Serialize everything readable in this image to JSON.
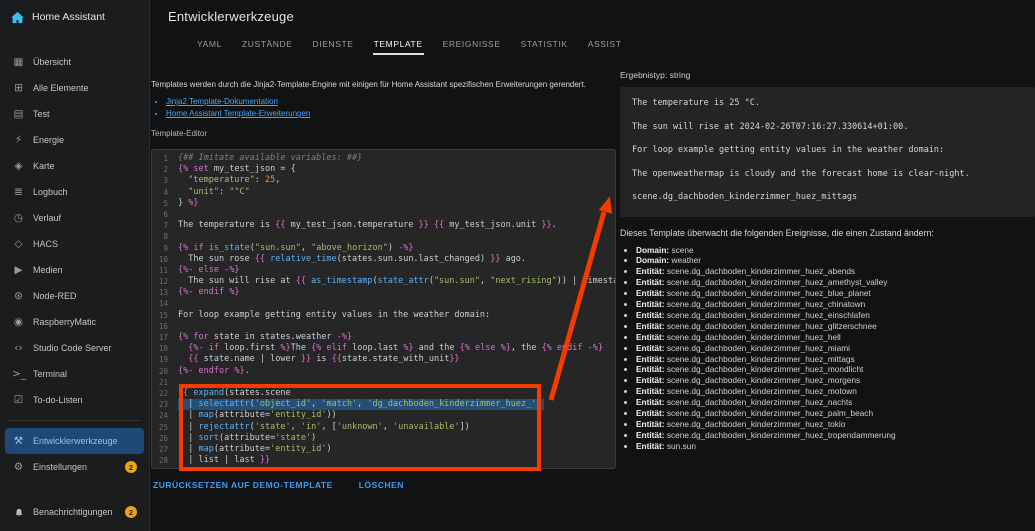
{
  "colors": {
    "accent": "#3d9df6",
    "active_item_bg": "#1e4976",
    "badge": "#eea410",
    "annotation": "#f53b00"
  },
  "sidebar": {
    "title": "Home Assistant",
    "items": [
      {
        "label": "Übersicht",
        "icon": "view-dashboard-icon",
        "glyph": "▦"
      },
      {
        "label": "Alle Elemente",
        "icon": "shapes-icon",
        "glyph": "⊞"
      },
      {
        "label": "Test",
        "icon": "grid-icon",
        "glyph": "▤"
      },
      {
        "label": "Energie",
        "icon": "lightning-icon",
        "glyph": "⚡"
      },
      {
        "label": "Karte",
        "icon": "map-icon",
        "glyph": "◈"
      },
      {
        "label": "Logbuch",
        "icon": "logbook-icon",
        "glyph": "≣"
      },
      {
        "label": "Verlauf",
        "icon": "history-clock-icon",
        "glyph": "◷"
      },
      {
        "label": "HACS",
        "icon": "hacs-icon",
        "glyph": "◇"
      },
      {
        "label": "Medien",
        "icon": "media-play-icon",
        "glyph": "▶"
      },
      {
        "label": "Node-RED",
        "icon": "node-red-icon",
        "glyph": "⊛"
      },
      {
        "label": "RaspberryMatic",
        "icon": "raspberrymatic-icon",
        "glyph": "◉"
      },
      {
        "label": "Studio Code Server",
        "icon": "code-brackets-icon",
        "glyph": "‹›"
      },
      {
        "label": "Terminal",
        "icon": "terminal-icon",
        "glyph": ">_"
      },
      {
        "label": "To-do-Listen",
        "icon": "todo-check-icon",
        "glyph": "☑"
      },
      {
        "label": "Entwicklerwerkzeuge",
        "icon": "hammer-icon",
        "glyph": "⚒",
        "active": true,
        "divider_before": true
      },
      {
        "label": "Einstellungen",
        "icon": "gear-icon",
        "glyph": "⚙",
        "badge": "2"
      }
    ],
    "bottom_item": {
      "label": "Benachrichtigungen",
      "icon": "bell-icon",
      "badge": "2"
    }
  },
  "header": {
    "title": "Entwicklerwerkzeuge"
  },
  "tabs": {
    "items": [
      "YAML",
      "ZUSTÄNDE",
      "DIENSTE",
      "TEMPLATE",
      "EREIGNISSE",
      "STATISTIK",
      "ASSIST"
    ],
    "active": "TEMPLATE"
  },
  "main": {
    "description": "Templates werden durch die Jinja2-Template-Engine mit einigen für Home Assistant spezifischen Erweiterungen gerendert.",
    "doc_links": [
      "Jinja2 Template-Dokumentation",
      "Home Assistant Template-Erweiterungen"
    ],
    "editor_label": "Template-Editor",
    "reset_button": "ZURÜCKSETZEN AUF DEMO-TEMPLATE",
    "clear_button": "LÖSCHEN"
  },
  "editor": {
    "highlighted_line": 23,
    "lines": [
      "{## Imitate available variables: ##}",
      "{% set my_test_json = {",
      "  \"temperature\": 25,",
      "  \"unit\": \"°C\"",
      "} %}",
      "",
      "The temperature is {{ my_test_json.temperature }} {{ my_test_json.unit }}.",
      "",
      "{% if is_state(\"sun.sun\", \"above_horizon\") -%}",
      "  The sun rose {{ relative_time(states.sun.sun.last_changed) }} ago.",
      "{%- else -%}",
      "  The sun will rise at {{ as_timestamp(state_attr(\"sun.sun\", \"next_rising\")) | timestamp_local }}.",
      "{%- endif %}",
      "",
      "For loop example getting entity values in the weather domain:",
      "",
      "{% for state in states.weather -%}",
      "  {%- if loop.first %}The {% elif loop.last %} and the {% else %}, the {% endif -%}",
      "  {{ state.name | lower }} is {{state.state_with_unit}}",
      "{%- endfor %}.",
      "",
      "{{ expand(states.scene",
      "  | selectattr('object_id', 'match', 'dg_dachboden_kinderzimmer_huez_')",
      "  | map(attribute='entity_id'))",
      "  | rejectattr('state', 'in', ['unknown', 'unavailable'])",
      "  | sort(attribute='state')",
      "  | map(attribute='entity_id')",
      "  | list | last }}"
    ]
  },
  "result": {
    "type_label": "Ergebnistyp: string",
    "output_lines": [
      "The temperature is 25 °C.",
      "The sun will rise at 2024-02-26T07:16:27.330614+01:00.",
      "For loop example getting entity values in the weather domain:",
      "The openweathermap is cloudy and the forecast home is clear-night.",
      "scene.dg_dachboden_kinderzimmer_huez_mittags"
    ],
    "watched_heading": "Dieses Template überwacht die folgenden Ereignisse, die einen Zustand ändern:",
    "watched": [
      {
        "label": "Domain",
        "value": "scene"
      },
      {
        "label": "Domain",
        "value": "weather"
      },
      {
        "label": "Entität",
        "value": "scene.dg_dachboden_kinderzimmer_huez_abends"
      },
      {
        "label": "Entität",
        "value": "scene.dg_dachboden_kinderzimmer_huez_amethyst_valley"
      },
      {
        "label": "Entität",
        "value": "scene.dg_dachboden_kinderzimmer_huez_blue_planet"
      },
      {
        "label": "Entität",
        "value": "scene.dg_dachboden_kinderzimmer_huez_chinatown"
      },
      {
        "label": "Entität",
        "value": "scene.dg_dachboden_kinderzimmer_huez_einschlafen"
      },
      {
        "label": "Entität",
        "value": "scene.dg_dachboden_kinderzimmer_huez_glitzerschnee"
      },
      {
        "label": "Entität",
        "value": "scene.dg_dachboden_kinderzimmer_huez_hell"
      },
      {
        "label": "Entität",
        "value": "scene.dg_dachboden_kinderzimmer_huez_miami"
      },
      {
        "label": "Entität",
        "value": "scene.dg_dachboden_kinderzimmer_huez_mittags"
      },
      {
        "label": "Entität",
        "value": "scene.dg_dachboden_kinderzimmer_huez_mondlicht"
      },
      {
        "label": "Entität",
        "value": "scene.dg_dachboden_kinderzimmer_huez_morgens"
      },
      {
        "label": "Entität",
        "value": "scene.dg_dachboden_kinderzimmer_huez_motown"
      },
      {
        "label": "Entität",
        "value": "scene.dg_dachboden_kinderzimmer_huez_nachts"
      },
      {
        "label": "Entität",
        "value": "scene.dg_dachboden_kinderzimmer_huez_palm_beach"
      },
      {
        "label": "Entität",
        "value": "scene.dg_dachboden_kinderzimmer_huez_tokio"
      },
      {
        "label": "Entität",
        "value": "scene.dg_dachboden_kinderzimmer_huez_tropendammerung"
      },
      {
        "label": "Entität",
        "value": "sun.sun"
      }
    ]
  },
  "annotation": {
    "color": "#f53b00"
  }
}
